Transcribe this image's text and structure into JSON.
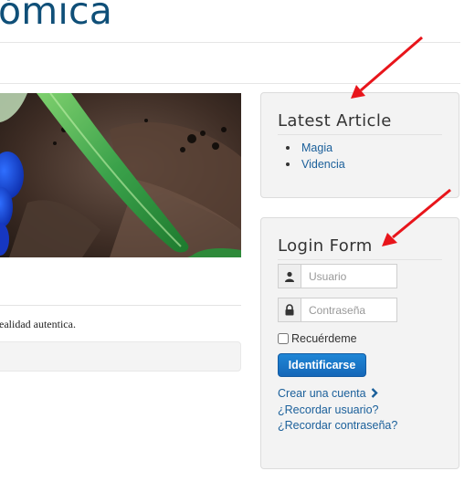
{
  "header": {
    "site_title": "ómica"
  },
  "article": {
    "text": "ealidad autentica."
  },
  "latest_articles": {
    "title": "Latest Article",
    "items": [
      {
        "label": "Magia"
      },
      {
        "label": "Videncia"
      }
    ]
  },
  "login_form": {
    "title": "Login Form",
    "username_placeholder": "Usuario",
    "password_placeholder": "Contraseña",
    "remember_label": "Recuérdeme",
    "submit_label": "Identificarse",
    "links": {
      "create_account": "Crear una cuenta",
      "forgot_username": "¿Recordar usuario?",
      "forgot_password": "¿Recordar contraseña?"
    }
  },
  "colors": {
    "title": "#0f4f78",
    "link": "#1a5f9a",
    "button": "#1567b8",
    "annotation_arrow": "#e8151b"
  },
  "icons": [
    "user-icon",
    "lock-icon",
    "chevron-right-icon",
    "annotation-arrow"
  ]
}
